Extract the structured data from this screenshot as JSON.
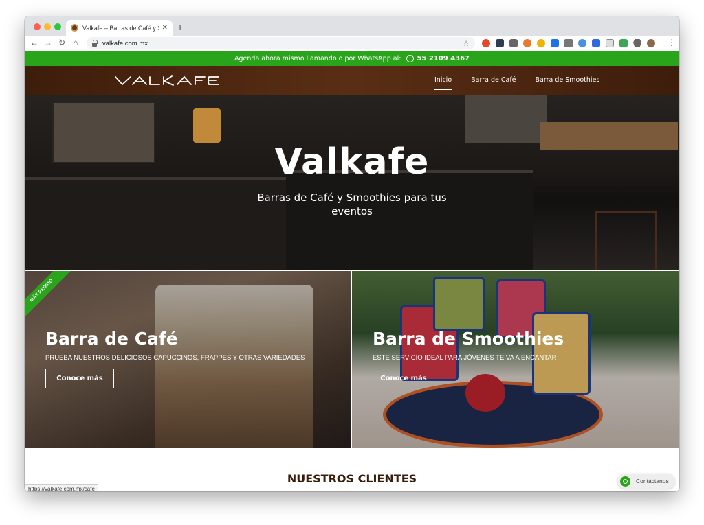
{
  "browser": {
    "tab_title": "Valkafe – Barras de Café y Smo",
    "url": "valkafe.com.mx",
    "status_url": "https://valkafe.com.mx/cafe"
  },
  "announce": {
    "text": "Agenda ahora mismo llamando o por WhatsApp al:",
    "phone": "55 2109 4367"
  },
  "nav": {
    "logo_text": "VALKAFE",
    "links": [
      "Inicio",
      "Barra de Café",
      "Barra de Smoothies"
    ]
  },
  "hero": {
    "title": "Valkafe",
    "subtitle": "Barras de Café y Smoothies para tus eventos"
  },
  "cards": [
    {
      "ribbon": "MÁS PEDIDO",
      "title": "Barra de Café",
      "desc": "PRUEBA NUESTROS DELICIOSOS CAPUCCINOS, FRAPPES Y OTRAS VARIEDADES",
      "button": "Conoce más"
    },
    {
      "title": "Barra de Smoothies",
      "desc": "ESTE SERVICIO IDEAL PARA JÓVENES TE VA A ENCANTAR",
      "button": "Conoce más"
    }
  ],
  "clients_heading": "NUESTROS CLIENTES",
  "contact": {
    "label": "Contáctanos"
  },
  "colors": {
    "green": "#2aa41b",
    "brown": "#4a2410"
  }
}
